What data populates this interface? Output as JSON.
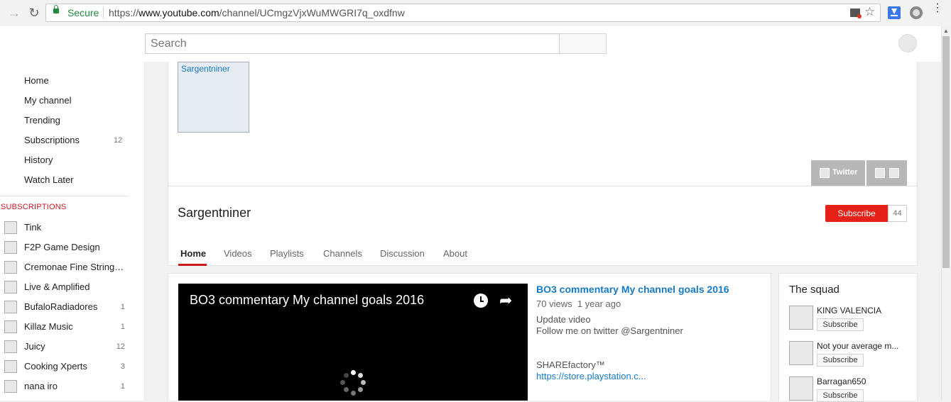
{
  "browser": {
    "secure_label": "Secure",
    "url_scheme": "https://",
    "url_host": "www.youtube.com",
    "url_path": "/channel/UCmgzVjxWuMWGRI7q_oxdfnw"
  },
  "masthead": {
    "search_placeholder": "Search"
  },
  "sidebar": {
    "items": [
      {
        "label": "Home",
        "count": ""
      },
      {
        "label": "My channel",
        "count": ""
      },
      {
        "label": "Trending",
        "count": ""
      },
      {
        "label": "Subscriptions",
        "count": "12"
      },
      {
        "label": "History",
        "count": ""
      },
      {
        "label": "Watch Later",
        "count": ""
      }
    ],
    "subscriptions_heading": "SUBSCRIPTIONS",
    "subscriptions": [
      {
        "name": "Tink",
        "count": ""
      },
      {
        "name": "F2P Game Design",
        "count": ""
      },
      {
        "name": "Cremonae Fine Stringe…",
        "count": ""
      },
      {
        "name": "Live & Amplified",
        "count": ""
      },
      {
        "name": "BufaloRadiadores",
        "count": "1"
      },
      {
        "name": "Killaz Music",
        "count": "1"
      },
      {
        "name": "Juicy",
        "count": "12"
      },
      {
        "name": "Cooking Xperts",
        "count": "3"
      },
      {
        "name": "nana iro",
        "count": "1"
      }
    ]
  },
  "channel": {
    "thumb_alt": "Sargentniner",
    "name": "Sargentniner",
    "twitter_label": "Twitter",
    "subscribe_label": "Subscribe",
    "subscriber_count": "44",
    "tabs": [
      "Home",
      "Videos",
      "Playlists",
      "Channels",
      "Discussion",
      "About"
    ]
  },
  "featured": {
    "player_title": "BO3 commentary My channel goals 2016",
    "title": "BO3 commentary My channel goals 2016",
    "views": "70 views",
    "age": "1 year ago",
    "desc_line1": "Update video",
    "desc_line2": "Follow me on twitter @Sargentniner",
    "desc_line3": "SHAREfactory™",
    "desc_link": "https://store.playstation.c..."
  },
  "squad": {
    "title": "The squad",
    "members": [
      {
        "name": "KING VALENCIA",
        "button": "Subscribe"
      },
      {
        "name": "Not your average m...",
        "button": "Subscribe"
      },
      {
        "name": "Barragan650",
        "button": "Subscribe"
      }
    ]
  },
  "colors": {
    "accent_red": "#e62117",
    "link_blue": "#167ac6",
    "secure_green": "#1e8e3e"
  }
}
